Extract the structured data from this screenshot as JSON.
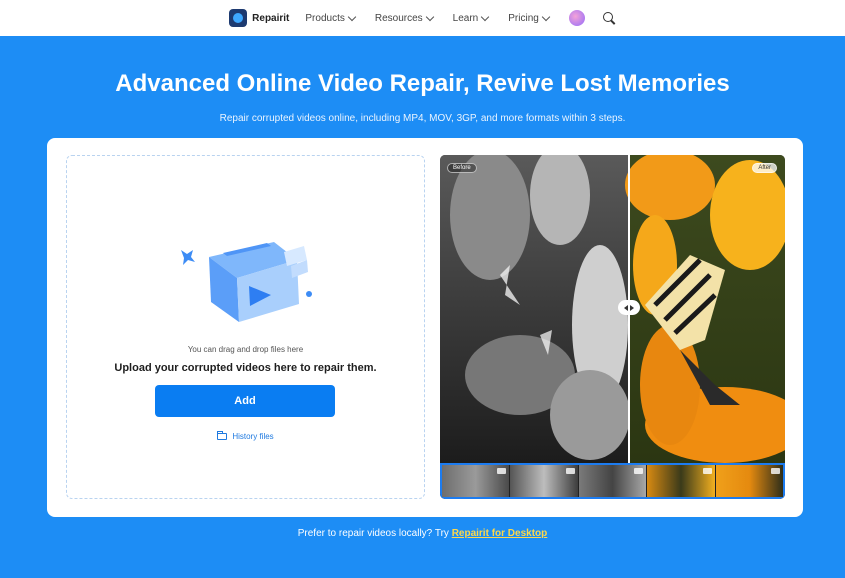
{
  "nav": {
    "brand": "Repairit",
    "items": [
      {
        "label": "Products"
      },
      {
        "label": "Resources"
      },
      {
        "label": "Learn"
      },
      {
        "label": "Pricing"
      }
    ]
  },
  "hero": {
    "title": "Advanced Online Video Repair, Revive Lost Memories",
    "subtitle": "Repair corrupted videos online, including MP4, MOV, 3GP, and more formats within 3 steps."
  },
  "upload": {
    "drag_hint": "You can drag and drop files here",
    "heading": "Upload your corrupted videos here to repair them.",
    "add_label": "Add",
    "history_label": "History files"
  },
  "compare": {
    "before_label": "Before",
    "after_label": "After",
    "split_fraction": 0.55,
    "thumbnail_count": 5
  },
  "footer": {
    "prefix": "Prefer to repair videos locally? Try",
    "link": "Repairit for Desktop"
  },
  "colors": {
    "hero_bg": "#1d8df5",
    "primary": "#0a7df2",
    "link_yellow": "#ffd84a"
  }
}
